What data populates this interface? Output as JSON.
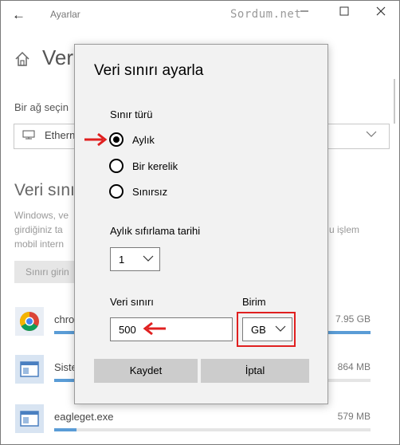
{
  "window": {
    "title": "Ayarlar",
    "watermark": "Sordum.net"
  },
  "background": {
    "heading": "Ver",
    "select_label": "Bir ağ seçin",
    "dropdown_value": "Ethern",
    "section_title": "Veri sınırı",
    "desc_line1": "Windows, ve",
    "desc_line2": "girdiğiniz ta",
    "desc_line3": "mobil intern",
    "desc_line2_end": "u işlem",
    "limit_button": "Sınırı girin",
    "apps": [
      {
        "name": "chro",
        "size": "7.95 GB",
        "usage_fraction": 1.0,
        "icon": "chrome-icon"
      },
      {
        "name": "Siste",
        "size": "864 MB",
        "usage_fraction": 0.11,
        "icon": "app-window-icon"
      },
      {
        "name": "eagleget.exe",
        "size": "579 MB",
        "usage_fraction": 0.07,
        "icon": "app-window-icon"
      }
    ]
  },
  "dialog": {
    "title": "Veri sınırı ayarla",
    "limit_type_label": "Sınır türü",
    "options": [
      {
        "label": "Aylık",
        "selected": true
      },
      {
        "label": "Bir kerelik",
        "selected": false
      },
      {
        "label": "Sınırsız",
        "selected": false
      }
    ],
    "reset_date_label": "Aylık sıfırlama tarihi",
    "reset_date_value": "1",
    "data_limit_label": "Veri sınırı",
    "data_limit_value": "500",
    "unit_label": "Birim",
    "unit_value": "GB",
    "save_button": "Kaydet",
    "cancel_button": "İptal"
  },
  "colors": {
    "annotation_red": "#e02020",
    "usage_bar": "#5a9cd6",
    "dialog_bg": "#f2f2f2",
    "button_bg": "#cccccc"
  }
}
